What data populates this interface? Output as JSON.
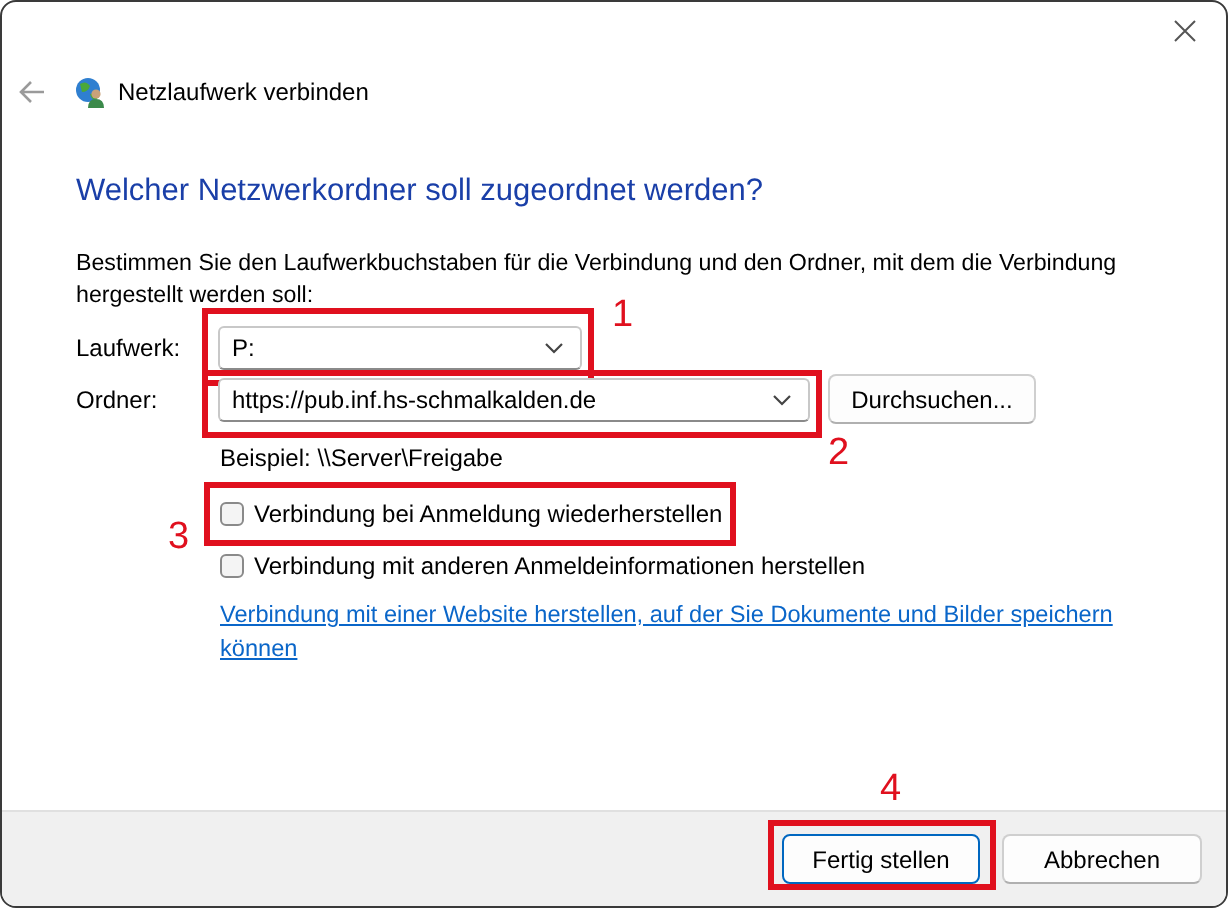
{
  "window": {
    "title": "Netzlaufwerk verbinden"
  },
  "heading": "Welcher Netzwerkordner soll zugeordnet werden?",
  "instructions": "Bestimmen Sie den Laufwerkbuchstaben für die Verbindung und den Ordner, mit dem die Verbindung hergestellt werden soll:",
  "drive": {
    "label": "Laufwerk:",
    "value": "P:"
  },
  "folder": {
    "label": "Ordner:",
    "value": "https://pub.inf.hs-schmalkalden.de",
    "browse_button": "Durchsuchen...",
    "example": "Beispiel: \\\\Server\\Freigabe"
  },
  "options": [
    {
      "label": "Verbindung bei Anmeldung wiederherstellen",
      "checked": false
    },
    {
      "label": "Verbindung mit anderen Anmeldeinformationen herstellen",
      "checked": false
    }
  ],
  "link": "Verbindung mit einer Website herstellen, auf der Sie Dokumente und Bilder speichern können",
  "buttons": [
    {
      "label": "Fertig stellen",
      "default": true
    },
    {
      "label": "Abbrechen",
      "default": false
    }
  ],
  "annotations": [
    {
      "label": "1"
    },
    {
      "label": "2"
    },
    {
      "label": "3"
    },
    {
      "label": "4"
    }
  ]
}
